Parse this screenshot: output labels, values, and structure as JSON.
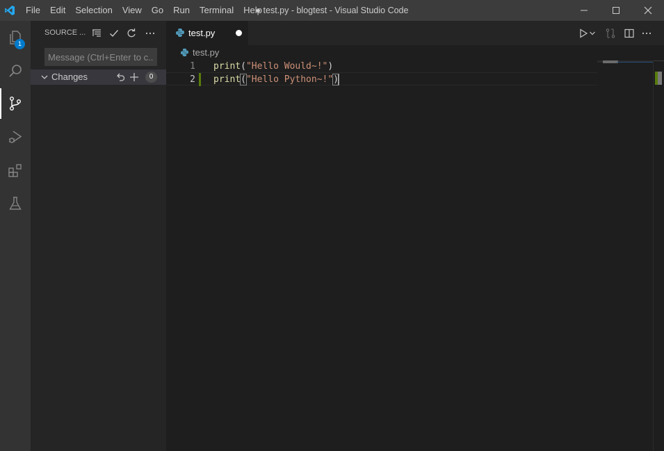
{
  "titlebar": {
    "logo": "vscode-logo",
    "menu": [
      "File",
      "Edit",
      "Selection",
      "View",
      "Go",
      "Run",
      "Terminal",
      "Help"
    ],
    "window_title": "● test.py - blogtest - Visual Studio Code",
    "controls": [
      "minimize-icon",
      "maximize-icon",
      "close-icon"
    ]
  },
  "activitybar": {
    "items": [
      {
        "icon": "files-icon",
        "badge": "1"
      },
      {
        "icon": "search-icon"
      },
      {
        "icon": "source-control-icon",
        "active": true
      },
      {
        "icon": "run-debug-icon"
      },
      {
        "icon": "extensions-icon"
      },
      {
        "icon": "testing-icon"
      }
    ]
  },
  "sidebar": {
    "title": "SOURCE ...",
    "actions": [
      "view-as-tree-icon",
      "commit-check-icon",
      "refresh-icon",
      "more-actions-icon"
    ],
    "commit_placeholder": "Message (Ctrl+Enter to c...",
    "changes": {
      "label": "Changes",
      "actions": [
        "discard-all-icon",
        "stage-all-icon"
      ],
      "count": "0"
    }
  },
  "editor": {
    "tab": {
      "label": "test.py",
      "icon": "python-icon",
      "dirty": true
    },
    "actions": [
      "run-python-file-icon",
      "chevron-down-icon",
      "open-changes-icon",
      "split-editor-icon",
      "more-actions-icon"
    ],
    "breadcrumb": "test.py",
    "lines": [
      {
        "number": "1",
        "fn": "print",
        "open": "(",
        "string": "\"Hello Would~!\"",
        "close": ")"
      },
      {
        "number": "2",
        "fn": "print",
        "open": "(",
        "string": "\"Hello Python~!\"",
        "close": ")"
      }
    ]
  },
  "colors": {
    "accent": "#007acc",
    "added_gutter": "#587c0c",
    "function": "#dcdcaa",
    "string": "#ce9178"
  }
}
